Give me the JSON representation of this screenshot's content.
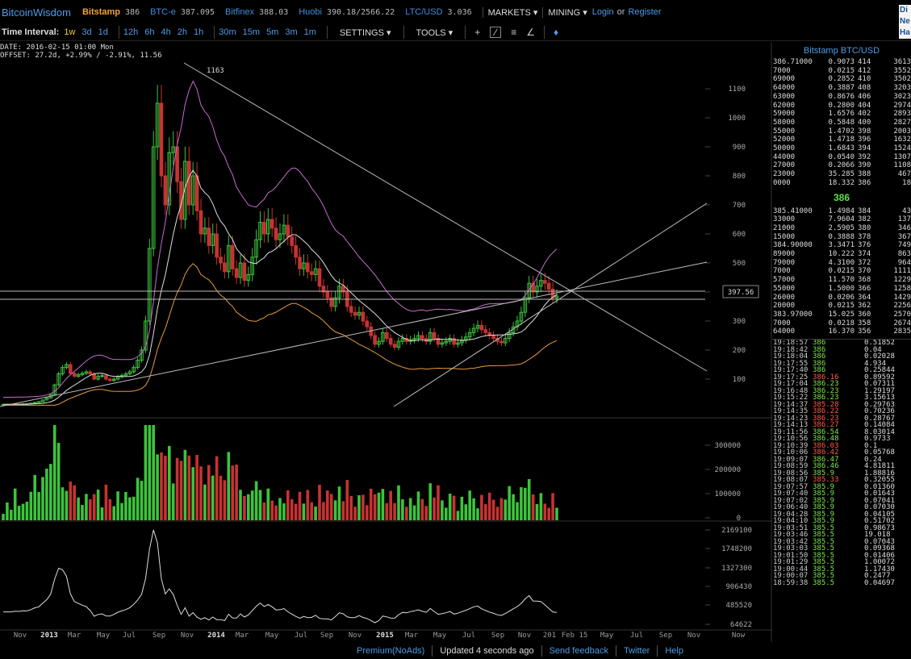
{
  "topbar": {
    "logo": "BitcoinWisdom",
    "exchanges": [
      {
        "name": "Bitstamp",
        "price": "386",
        "active": true
      },
      {
        "name": "BTC-e",
        "price": "387.095",
        "active": false
      },
      {
        "name": "Bitfinex",
        "price": "388.03",
        "active": false
      },
      {
        "name": "Huobi",
        "price": "390.18/2566.22",
        "active": false
      },
      {
        "name": "LTC/USD",
        "price": "3.036",
        "active": false
      }
    ],
    "markets_label": "MARKETS",
    "mining_label": "MINING",
    "login_label": "Login",
    "or_label": "or",
    "register_label": "Register",
    "corner_lines": [
      "Di",
      "Ne",
      "Ha"
    ]
  },
  "toolbar": {
    "interval_label": "Time Interval:",
    "intervals": [
      "1w",
      "3d",
      "1d",
      "12h",
      "6h",
      "4h",
      "2h",
      "1h",
      "30m",
      "15m",
      "5m",
      "3m",
      "1m"
    ],
    "selected_interval": "1w",
    "settings_label": "SETTINGS",
    "tools_label": "TOOLS"
  },
  "chart_info": {
    "date_line": "DATE: 2016-02-15 01:00 Mon",
    "offset_line": "OFFSET: 27.2d, +2.99% / -2.91%, 11.56"
  },
  "chart_data": {
    "type": "line",
    "price_axis_ticks": [
      "1100",
      "1000",
      "900",
      "800",
      "700",
      "600",
      "500",
      "400",
      "300",
      "200",
      "100"
    ],
    "peak_label": "1163",
    "cursor_price": "397.56",
    "volume_axis_ticks": [
      "300000",
      "200000",
      "100000",
      "0"
    ],
    "indicator_axis_ticks": [
      "2169100",
      "1748200",
      "1327300",
      "906430",
      "485520",
      "64622"
    ],
    "x_tick_labels": [
      "Nov",
      "2013",
      "Mar",
      "May",
      "Jul",
      "Sep",
      "Nov",
      "2014",
      "Mar",
      "May",
      "Jul",
      "Sep",
      "Nov",
      "2015",
      "Mar",
      "May",
      "Jul",
      "Sep",
      "Nov",
      "201",
      "Feb 15",
      "May",
      "Jul",
      "Sep",
      "Nov",
      "Now"
    ],
    "bold_x_labels": [
      "2013",
      "2014",
      "2015"
    ],
    "colors": {
      "up": "#3cc43c",
      "down": "#c83232",
      "bollinger": "#c86ad0",
      "ma": "#dddddd",
      "support": "#e89a3c",
      "trendline": "#bbbbbb"
    }
  },
  "orderbook": {
    "title": "Bitstamp BTC/USD",
    "asks": [
      [
        "386.71000",
        "0.9073",
        "414",
        "3613"
      ],
      [
        "7000",
        "0.0215",
        "412",
        "3552"
      ],
      [
        "69000",
        "0.2852",
        "410",
        "3502"
      ],
      [
        "64000",
        "0.3887",
        "408",
        "3203"
      ],
      [
        "63000",
        "0.8676",
        "406",
        "3023"
      ],
      [
        "62000",
        "0.2800",
        "404",
        "2974"
      ],
      [
        "59000",
        "1.6576",
        "402",
        "2893"
      ],
      [
        "58000",
        "0.5848",
        "400",
        "2827"
      ],
      [
        "55000",
        "1.4702",
        "398",
        "2003"
      ],
      [
        "52000",
        "1.4718",
        "396",
        "1632"
      ],
      [
        "50000",
        "1.6843",
        "394",
        "1524"
      ],
      [
        "44000",
        "0.0540",
        "392",
        "1307"
      ],
      [
        "27000",
        "0.2066",
        "390",
        "1108"
      ],
      [
        "23000",
        "35.285",
        "388",
        "467"
      ],
      [
        "0000",
        "18.332",
        "386",
        "18"
      ]
    ],
    "mid_price": "386",
    "bids": [
      [
        "385.41000",
        "1.4984",
        "384",
        "43"
      ],
      [
        "33000",
        "7.9604",
        "382",
        "137"
      ],
      [
        "21000",
        "2.5905",
        "380",
        "346"
      ],
      [
        "15000",
        "0.3888",
        "378",
        "367"
      ],
      [
        "384.90000",
        "3.3471",
        "376",
        "749"
      ],
      [
        "89000",
        "10.222",
        "374",
        "863"
      ],
      [
        "79000",
        "4.3100",
        "372",
        "964"
      ],
      [
        "7000",
        "0.0215",
        "370",
        "1111"
      ],
      [
        "57000",
        "11.570",
        "368",
        "1229"
      ],
      [
        "55000",
        "1.5000",
        "366",
        "1258"
      ],
      [
        "26000",
        "0.0206",
        "364",
        "1429"
      ],
      [
        "20000",
        "0.0215",
        "362",
        "2256"
      ],
      [
        "383.97000",
        "15.025",
        "360",
        "2570"
      ],
      [
        "7000",
        "0.0218",
        "358",
        "2674"
      ],
      [
        "64000",
        "16.370",
        "356",
        "2835"
      ]
    ]
  },
  "trades": [
    [
      "19:18:57",
      "386",
      "eq",
      "0.51852"
    ],
    [
      "19:18:42",
      "386",
      "eq",
      "0.04"
    ],
    [
      "19:18:04",
      "386",
      "eq",
      "0.02028"
    ],
    [
      "19:17:55",
      "386",
      "eq",
      "4.934"
    ],
    [
      "19:17:40",
      "386",
      "eq",
      "0.25844"
    ],
    [
      "19:17:25",
      "386.16",
      "dn",
      "0.89592"
    ],
    [
      "19:17:04",
      "386.23",
      "up",
      "0.07311"
    ],
    [
      "19:16:48",
      "386.23",
      "up",
      "1.29197"
    ],
    [
      "19:15:22",
      "386.23",
      "up",
      "3.15613"
    ],
    [
      "19:14:37",
      "385.28",
      "dn",
      "0.29763"
    ],
    [
      "19:14:35",
      "386.22",
      "dn",
      "0.70236"
    ],
    [
      "19:14:23",
      "386.23",
      "dn",
      "0.28767"
    ],
    [
      "19:14:13",
      "386.27",
      "dn",
      "0.14084"
    ],
    [
      "19:11:56",
      "386.54",
      "up",
      "8.03014"
    ],
    [
      "19:10:56",
      "386.48",
      "up",
      "0.9733"
    ],
    [
      "19:10:39",
      "386.03",
      "dn",
      "0.1"
    ],
    [
      "19:10:06",
      "386.42",
      "dn",
      "0.05768"
    ],
    [
      "19:09:07",
      "386.47",
      "up",
      "0.24"
    ],
    [
      "19:08:59",
      "386.46",
      "up",
      "4.81811"
    ],
    [
      "19:08:56",
      "385.9",
      "up",
      "1.88816"
    ],
    [
      "19:08:07",
      "385.33",
      "dn",
      "0.32055"
    ],
    [
      "19:07:57",
      "385.9",
      "up",
      "0.01360"
    ],
    [
      "19:07:40",
      "385.9",
      "eq",
      "0.01643"
    ],
    [
      "19:07:02",
      "385.9",
      "eq",
      "0.07041"
    ],
    [
      "19:06:40",
      "385.9",
      "eq",
      "0.07030"
    ],
    [
      "19:04:28",
      "385.9",
      "eq",
      "0.04105"
    ],
    [
      "19:04:10",
      "385.9",
      "eq",
      "0.51702"
    ],
    [
      "19:03:51",
      "385.5",
      "up",
      "0.98673"
    ],
    [
      "19:03:46",
      "385.5",
      "eq",
      "19.018"
    ],
    [
      "19:03:42",
      "385.5",
      "eq",
      "0.07043"
    ],
    [
      "19:03:03",
      "385.5",
      "eq",
      "0.09368"
    ],
    [
      "19:01:50",
      "385.5",
      "eq",
      "0.01406"
    ],
    [
      "19:01:29",
      "385.5",
      "eq",
      "1.00072"
    ],
    [
      "19:00:44",
      "385.5",
      "eq",
      "1.17430"
    ],
    [
      "19:00:07",
      "385.5",
      "eq",
      "0.2477"
    ],
    [
      "18:59:38",
      "385.5",
      "eq",
      "0.04697"
    ]
  ],
  "footer": {
    "premium_label": "Premium(NoAds)",
    "updated_label": "Updated 4 seconds ago",
    "feedback_label": "Send feedback",
    "twitter_label": "Twitter",
    "help_label": "Help"
  }
}
